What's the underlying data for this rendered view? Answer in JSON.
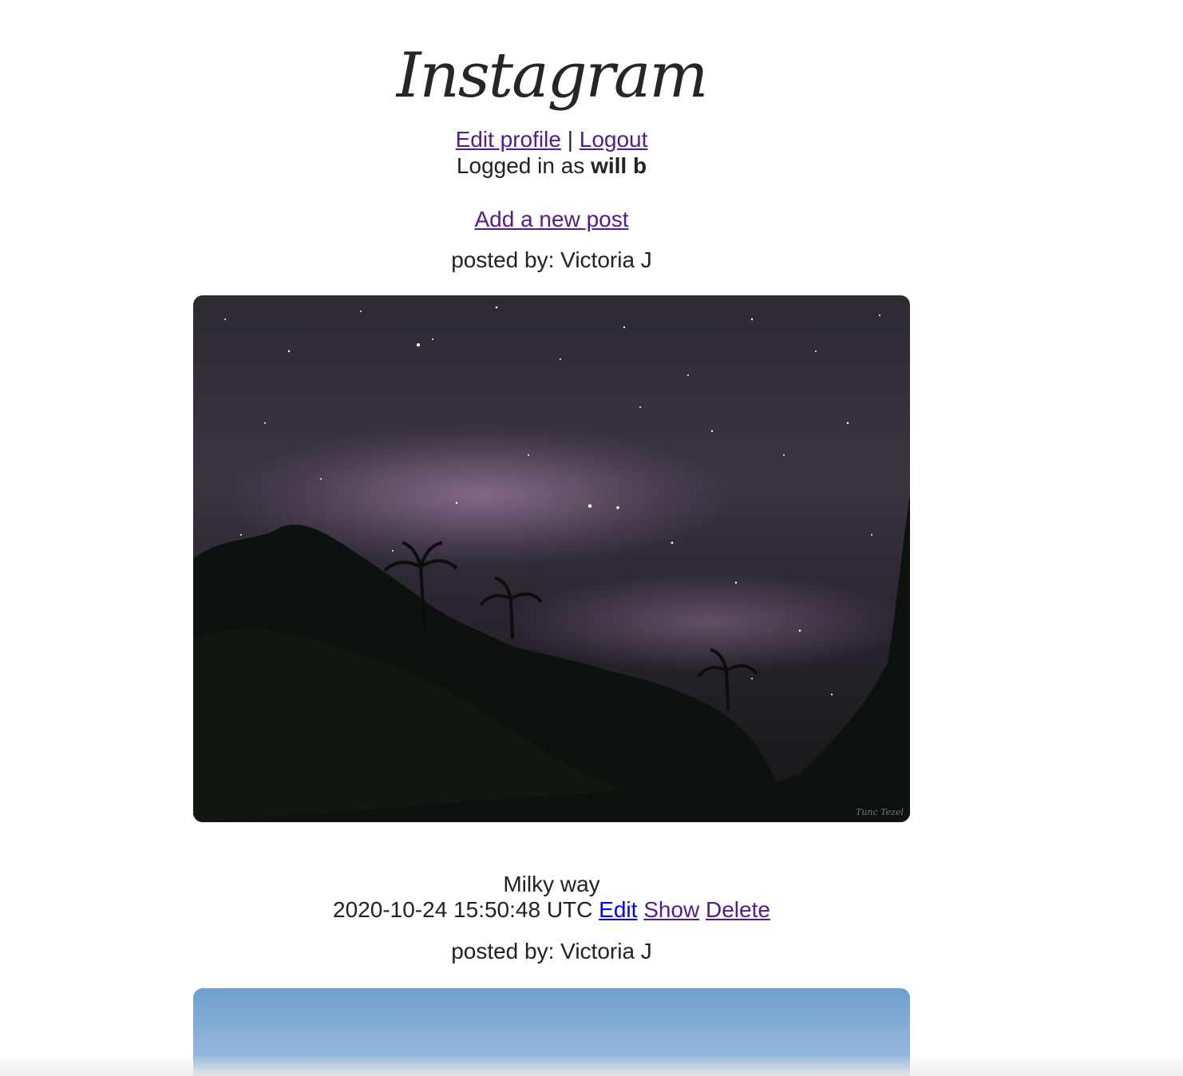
{
  "header": {
    "logo_text": "Instagram",
    "edit_profile_label": "Edit profile",
    "separator": "|",
    "logout_label": "Logout",
    "logged_in_prefix": "Logged in as",
    "username": "will b",
    "add_post_label": "Add a new post"
  },
  "posts": [
    {
      "posted_by": "posted by: Victoria J",
      "image_icon": "milky-way-photo",
      "image_credit": "Tunc Tezel",
      "caption": "Milky way",
      "timestamp": "2020-10-24 15:50:48 UTC",
      "edit_label": "Edit",
      "show_label": "Show",
      "delete_label": "Delete"
    },
    {
      "posted_by": "posted by: Victoria J",
      "image_icon": "sky-photo"
    }
  ],
  "colors": {
    "link_visited": "#551a8b",
    "link_unvisited": "#0000ee",
    "text": "#222222"
  }
}
